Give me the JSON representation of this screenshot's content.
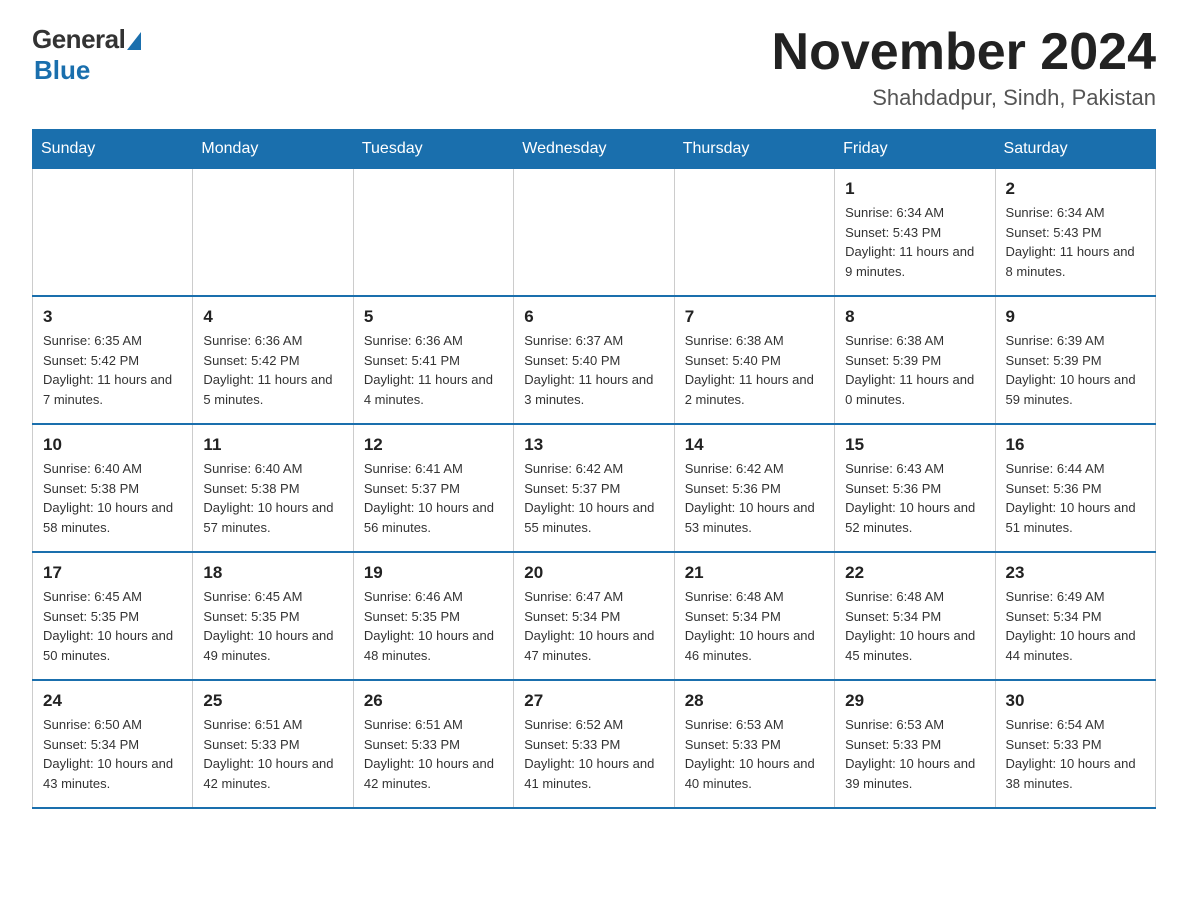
{
  "header": {
    "logo_general": "General",
    "logo_blue": "Blue",
    "month_title": "November 2024",
    "location": "Shahdadpur, Sindh, Pakistan"
  },
  "days_of_week": [
    "Sunday",
    "Monday",
    "Tuesday",
    "Wednesday",
    "Thursday",
    "Friday",
    "Saturday"
  ],
  "weeks": [
    [
      {
        "day": "",
        "info": ""
      },
      {
        "day": "",
        "info": ""
      },
      {
        "day": "",
        "info": ""
      },
      {
        "day": "",
        "info": ""
      },
      {
        "day": "",
        "info": ""
      },
      {
        "day": "1",
        "info": "Sunrise: 6:34 AM\nSunset: 5:43 PM\nDaylight: 11 hours and 9 minutes."
      },
      {
        "day": "2",
        "info": "Sunrise: 6:34 AM\nSunset: 5:43 PM\nDaylight: 11 hours and 8 minutes."
      }
    ],
    [
      {
        "day": "3",
        "info": "Sunrise: 6:35 AM\nSunset: 5:42 PM\nDaylight: 11 hours and 7 minutes."
      },
      {
        "day": "4",
        "info": "Sunrise: 6:36 AM\nSunset: 5:42 PM\nDaylight: 11 hours and 5 minutes."
      },
      {
        "day": "5",
        "info": "Sunrise: 6:36 AM\nSunset: 5:41 PM\nDaylight: 11 hours and 4 minutes."
      },
      {
        "day": "6",
        "info": "Sunrise: 6:37 AM\nSunset: 5:40 PM\nDaylight: 11 hours and 3 minutes."
      },
      {
        "day": "7",
        "info": "Sunrise: 6:38 AM\nSunset: 5:40 PM\nDaylight: 11 hours and 2 minutes."
      },
      {
        "day": "8",
        "info": "Sunrise: 6:38 AM\nSunset: 5:39 PM\nDaylight: 11 hours and 0 minutes."
      },
      {
        "day": "9",
        "info": "Sunrise: 6:39 AM\nSunset: 5:39 PM\nDaylight: 10 hours and 59 minutes."
      }
    ],
    [
      {
        "day": "10",
        "info": "Sunrise: 6:40 AM\nSunset: 5:38 PM\nDaylight: 10 hours and 58 minutes."
      },
      {
        "day": "11",
        "info": "Sunrise: 6:40 AM\nSunset: 5:38 PM\nDaylight: 10 hours and 57 minutes."
      },
      {
        "day": "12",
        "info": "Sunrise: 6:41 AM\nSunset: 5:37 PM\nDaylight: 10 hours and 56 minutes."
      },
      {
        "day": "13",
        "info": "Sunrise: 6:42 AM\nSunset: 5:37 PM\nDaylight: 10 hours and 55 minutes."
      },
      {
        "day": "14",
        "info": "Sunrise: 6:42 AM\nSunset: 5:36 PM\nDaylight: 10 hours and 53 minutes."
      },
      {
        "day": "15",
        "info": "Sunrise: 6:43 AM\nSunset: 5:36 PM\nDaylight: 10 hours and 52 minutes."
      },
      {
        "day": "16",
        "info": "Sunrise: 6:44 AM\nSunset: 5:36 PM\nDaylight: 10 hours and 51 minutes."
      }
    ],
    [
      {
        "day": "17",
        "info": "Sunrise: 6:45 AM\nSunset: 5:35 PM\nDaylight: 10 hours and 50 minutes."
      },
      {
        "day": "18",
        "info": "Sunrise: 6:45 AM\nSunset: 5:35 PM\nDaylight: 10 hours and 49 minutes."
      },
      {
        "day": "19",
        "info": "Sunrise: 6:46 AM\nSunset: 5:35 PM\nDaylight: 10 hours and 48 minutes."
      },
      {
        "day": "20",
        "info": "Sunrise: 6:47 AM\nSunset: 5:34 PM\nDaylight: 10 hours and 47 minutes."
      },
      {
        "day": "21",
        "info": "Sunrise: 6:48 AM\nSunset: 5:34 PM\nDaylight: 10 hours and 46 minutes."
      },
      {
        "day": "22",
        "info": "Sunrise: 6:48 AM\nSunset: 5:34 PM\nDaylight: 10 hours and 45 minutes."
      },
      {
        "day": "23",
        "info": "Sunrise: 6:49 AM\nSunset: 5:34 PM\nDaylight: 10 hours and 44 minutes."
      }
    ],
    [
      {
        "day": "24",
        "info": "Sunrise: 6:50 AM\nSunset: 5:34 PM\nDaylight: 10 hours and 43 minutes."
      },
      {
        "day": "25",
        "info": "Sunrise: 6:51 AM\nSunset: 5:33 PM\nDaylight: 10 hours and 42 minutes."
      },
      {
        "day": "26",
        "info": "Sunrise: 6:51 AM\nSunset: 5:33 PM\nDaylight: 10 hours and 42 minutes."
      },
      {
        "day": "27",
        "info": "Sunrise: 6:52 AM\nSunset: 5:33 PM\nDaylight: 10 hours and 41 minutes."
      },
      {
        "day": "28",
        "info": "Sunrise: 6:53 AM\nSunset: 5:33 PM\nDaylight: 10 hours and 40 minutes."
      },
      {
        "day": "29",
        "info": "Sunrise: 6:53 AM\nSunset: 5:33 PM\nDaylight: 10 hours and 39 minutes."
      },
      {
        "day": "30",
        "info": "Sunrise: 6:54 AM\nSunset: 5:33 PM\nDaylight: 10 hours and 38 minutes."
      }
    ]
  ]
}
